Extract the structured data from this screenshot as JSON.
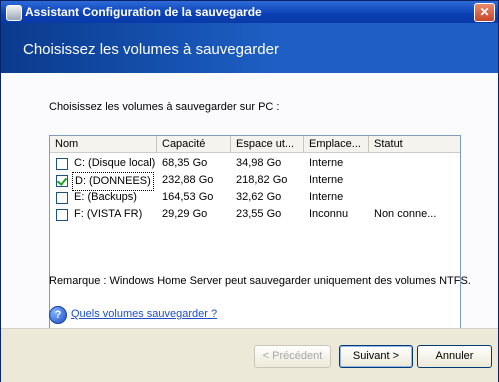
{
  "window": {
    "title": "Assistant Configuration de la sauvegarde"
  },
  "banner": {
    "heading": "Choisissez les volumes à sauvegarder"
  },
  "content": {
    "instruction": "Choisissez les volumes à sauvegarder sur PC :",
    "columns": [
      "Nom",
      "Capacité",
      "Espace ut...",
      "Emplace...",
      "Statut"
    ],
    "rows": [
      {
        "checked": false,
        "name": "C: (Disque local)",
        "capacity": "68,35 Go",
        "used": "34,98 Go",
        "location": "Interne",
        "status": ""
      },
      {
        "checked": true,
        "name": "D: (DONNEES)",
        "capacity": "232,88 Go",
        "used": "218,82 Go",
        "location": "Interne",
        "status": ""
      },
      {
        "checked": false,
        "name": "E: (Backups)",
        "capacity": "164,53 Go",
        "used": "32,62 Go",
        "location": "Interne",
        "status": ""
      },
      {
        "checked": false,
        "name": "F: (VISTA FR)",
        "capacity": "29,29 Go",
        "used": "23,55 Go",
        "location": "Inconnu",
        "status": "Non conne..."
      }
    ],
    "note": "Remarque : Windows Home Server peut sauvegarder uniquement des volumes NTFS.",
    "help_link": "Quels volumes sauvegarder ?"
  },
  "footer": {
    "prev": "< Précédent",
    "next": "Suivant >",
    "cancel": "Annuler"
  }
}
